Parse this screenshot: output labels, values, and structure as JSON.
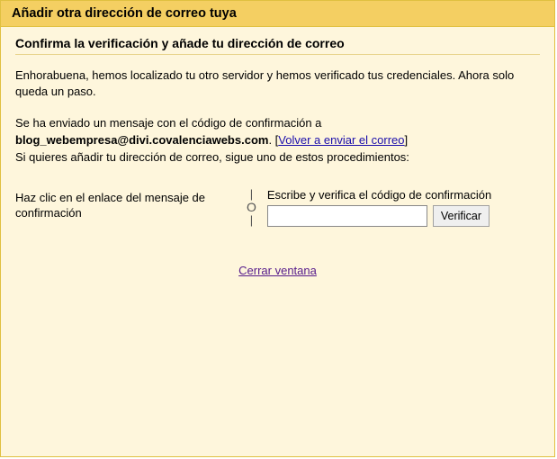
{
  "title": "Añadir otra dirección de correo tuya",
  "subtitle": "Confirma la verificación y añade tu dirección de correo",
  "congrats": "Enhorabuena, hemos localizado tu otro servidor y hemos verificado tus credenciales. Ahora solo queda un paso.",
  "info": {
    "line1": "Se ha enviado un mensaje con el código de confirmación a",
    "email": "blog_webempresa@divi.covalenciawebs.com",
    "dot": ". [",
    "resend": "Volver a enviar el correo",
    "bracket_close": "]",
    "line2": "Si quieres añadir tu dirección de correo, sigue uno de estos procedimientos:"
  },
  "left_option": "Haz clic en el enlace del mensaje de confirmación",
  "divider": "O",
  "right_option": {
    "label": "Escribe y verifica el código de confirmación",
    "placeholder": "",
    "value": "",
    "button": "Verificar"
  },
  "close_label": "Cerrar ventana"
}
